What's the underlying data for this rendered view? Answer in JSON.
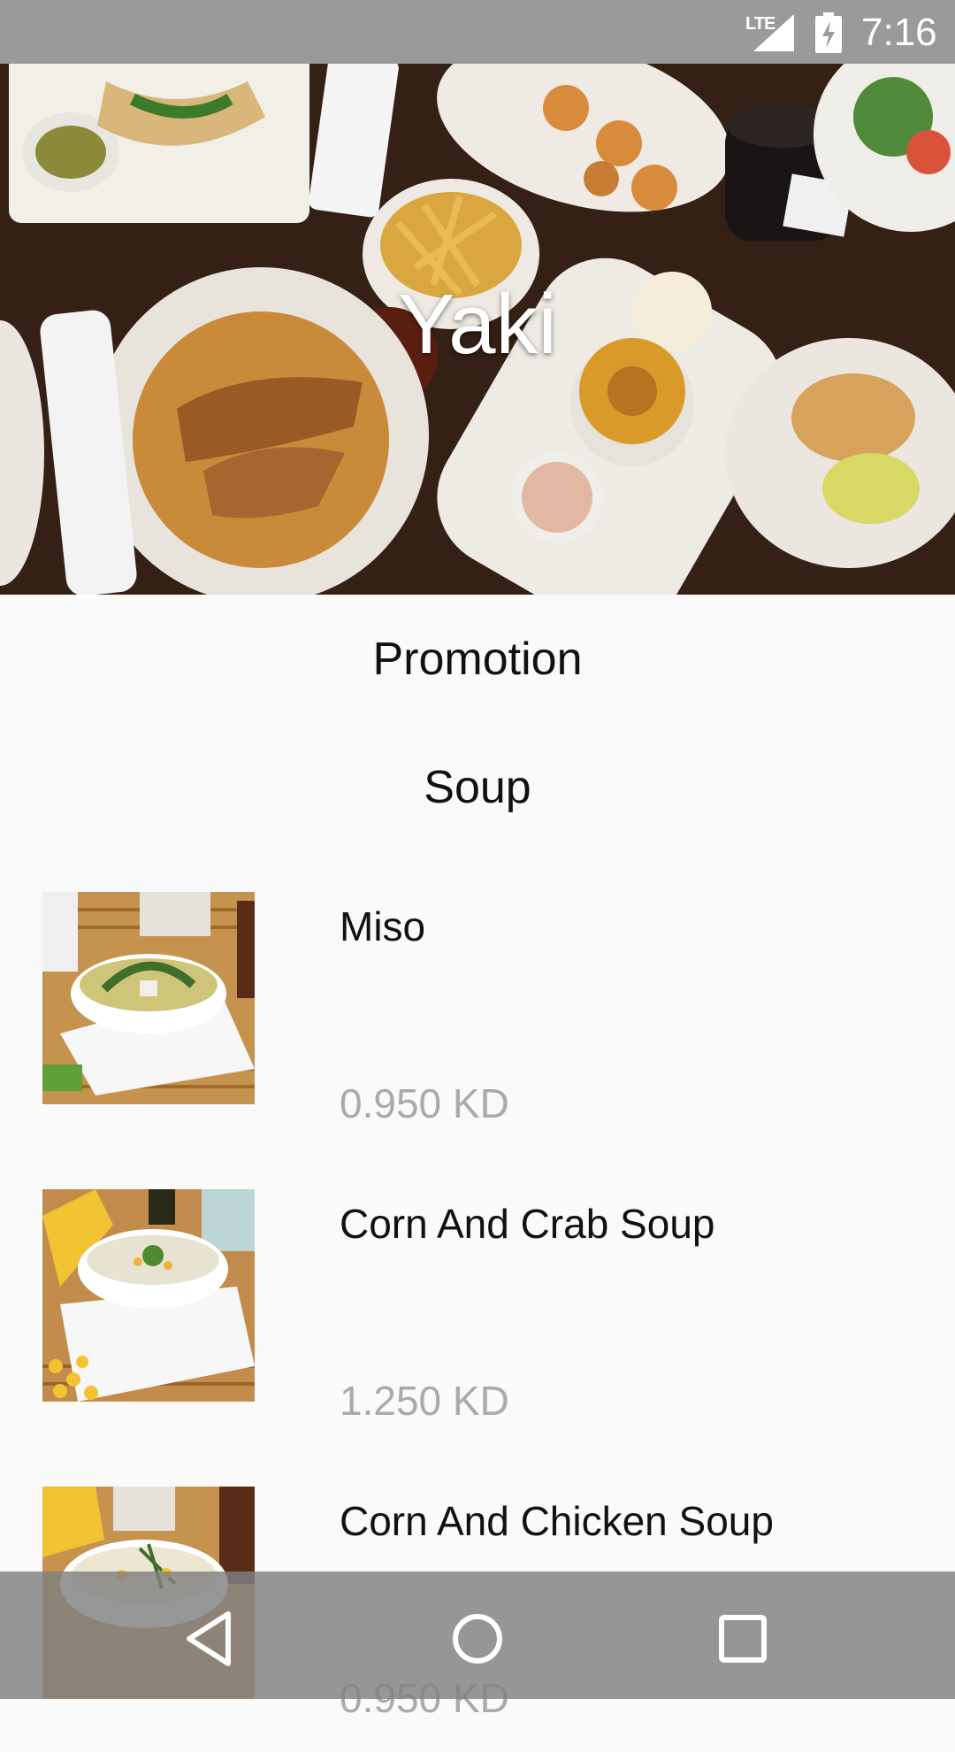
{
  "status_bar": {
    "network": "LTE",
    "time": "7:16",
    "icons": [
      "signal-icon",
      "battery-charging-icon"
    ]
  },
  "hero": {
    "title": "Yaki"
  },
  "sections": {
    "promotion_label": "Promotion",
    "category_label": "Soup"
  },
  "menu": {
    "items": [
      {
        "name": "Miso",
        "price": "0.950 KD"
      },
      {
        "name": "Corn And Crab Soup",
        "price": "1.250 KD"
      },
      {
        "name": "Corn And Chicken Soup",
        "price": "0.950 KD"
      }
    ]
  },
  "nav_bar": {
    "icons": [
      "back-icon",
      "home-icon",
      "recents-icon"
    ]
  },
  "colors": {
    "status_bar": "#9a9a9a",
    "background": "#fafafa",
    "price_text": "#aaaaaa"
  }
}
